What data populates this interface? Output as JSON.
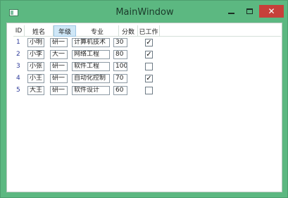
{
  "window": {
    "title": "MainWindow",
    "minimize_glyph": "",
    "maximize_glyph": "",
    "close_glyph": "✕"
  },
  "grid": {
    "columns": [
      "ID",
      "姓名",
      "年级",
      "专业",
      "分数",
      "已工作"
    ],
    "selected_column": "年级",
    "rows": [
      {
        "id": "1",
        "name": "小明",
        "grade": "研一",
        "major": "计算机技术",
        "score": "30",
        "employed": true
      },
      {
        "id": "2",
        "name": "小李",
        "grade": "大一",
        "major": "网络工程",
        "score": "80",
        "employed": true
      },
      {
        "id": "3",
        "name": "小张",
        "grade": "研一",
        "major": "软件工程",
        "score": "100",
        "employed": false
      },
      {
        "id": "4",
        "name": "小王",
        "grade": "研一",
        "major": "自动化控制",
        "score": "70",
        "employed": true
      },
      {
        "id": "5",
        "name": "大王",
        "grade": "研一",
        "major": "软件设计",
        "score": "60",
        "employed": false
      }
    ]
  },
  "colors": {
    "title_bar": "#5cb881",
    "close_button": "#c7403a",
    "id_text": "#2d3a9a",
    "selected_header": "#cfe7f7"
  },
  "icons": {
    "app": "window-icon",
    "minimize": "minimize-icon",
    "maximize": "maximize-icon",
    "close": "close-icon",
    "checked": "checkmark-icon"
  }
}
